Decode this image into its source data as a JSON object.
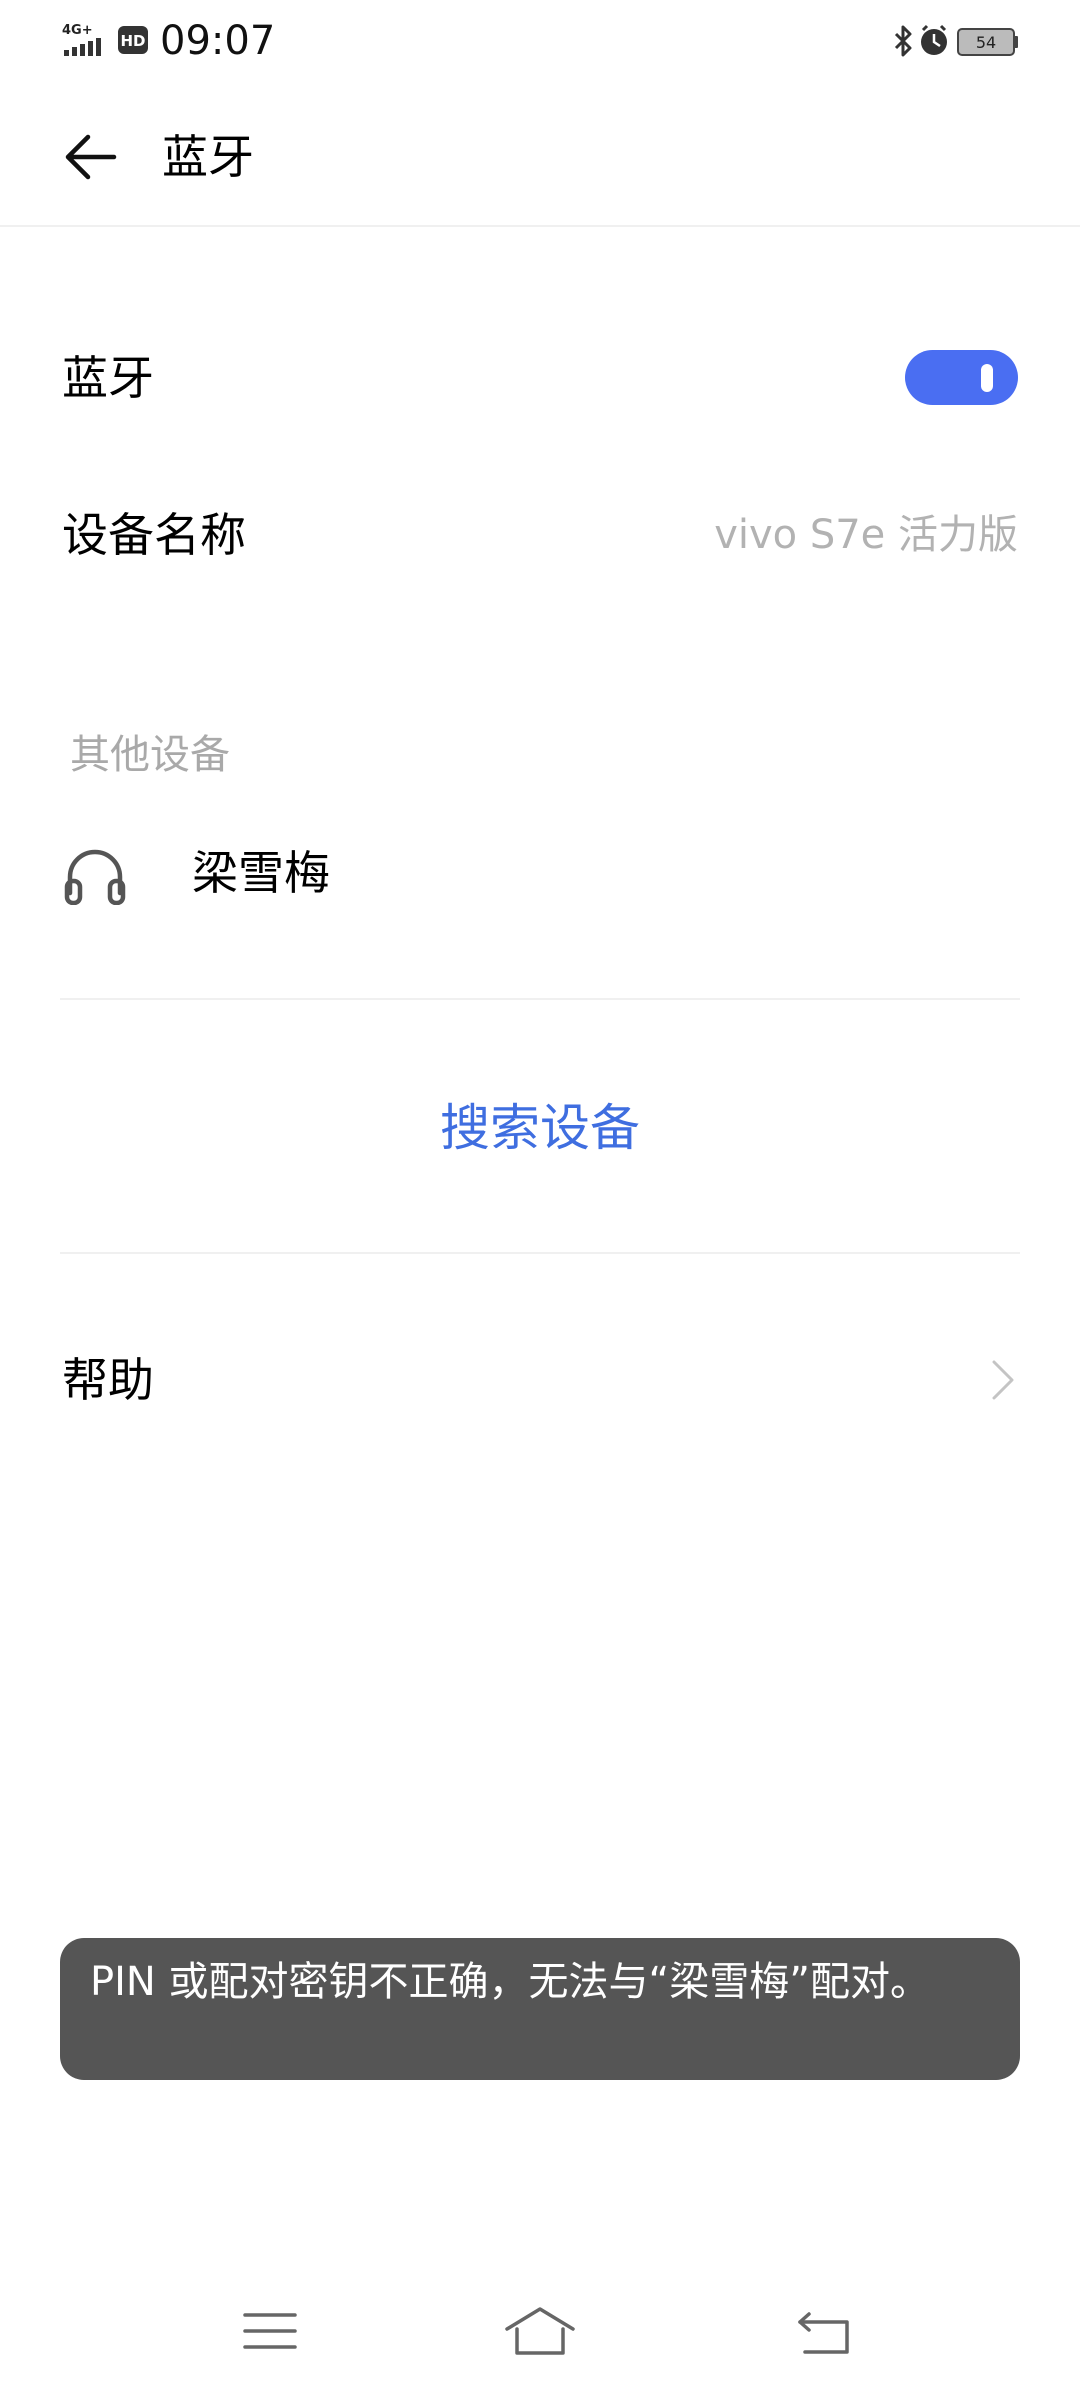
{
  "status_bar": {
    "time": "09:07",
    "network_label": "4G+",
    "hd_label": "HD",
    "battery_level": "54",
    "icons": [
      "signal-icon",
      "hd-icon",
      "bluetooth-icon",
      "alarm-icon",
      "battery-icon"
    ]
  },
  "header": {
    "title": "蓝牙",
    "back_icon": "arrow-left-icon"
  },
  "bluetooth": {
    "label": "蓝牙",
    "enabled": true,
    "toggle_color": "#4a6ef2"
  },
  "device_name": {
    "label": "设备名称",
    "value": "vivo S7e 活力版"
  },
  "other_devices": {
    "header": "其他设备",
    "items": [
      {
        "name": "梁雪梅",
        "icon": "headphones-icon"
      }
    ]
  },
  "search": {
    "label": "搜索设备",
    "color": "#3f6ee0"
  },
  "help": {
    "label": "帮助",
    "icon": "chevron-right-icon"
  },
  "toast": {
    "message": "PIN 或配对密钥不正确，无法与“梁雪梅”配对。"
  },
  "nav_bar": {
    "icons": [
      "menu-icon",
      "home-icon",
      "back-icon"
    ]
  }
}
